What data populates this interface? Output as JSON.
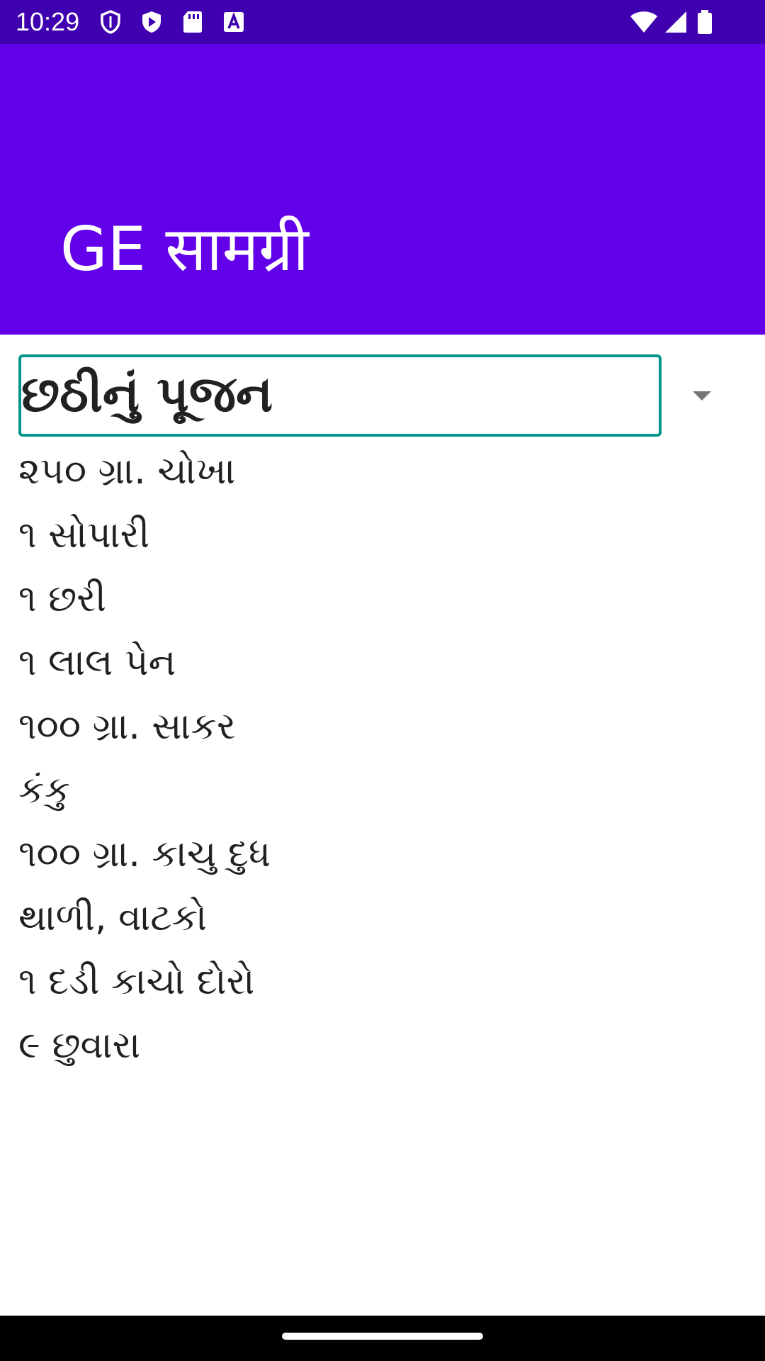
{
  "status_bar": {
    "time": "10:29",
    "left_icons": [
      "shield-icon",
      "play-protect-icon",
      "sd-card-icon",
      "font-a-icon"
    ],
    "right_icons": [
      "wifi-icon",
      "signal-icon",
      "battery-icon"
    ]
  },
  "app_bar": {
    "title": "GE सामग्री",
    "background": "#6200EA"
  },
  "spinner": {
    "selected": "છઠીનું પૂજન",
    "border_color": "#00968A",
    "arrow_icon": "dropdown-arrow-icon"
  },
  "items": [
    "૨૫૦ ગ્રા. ચોખા",
    "૧ સોપારી",
    "૧ છરી",
    "૧ લાલ પેન",
    "૧૦૦ ગ્રા. સાકર",
    "કંકુ",
    "૧૦૦ ગ્રા. કાચુ દુધ",
    "થાળી, વાટકો",
    "૧ દડી કાચો દોરો",
    "૯ છુવારા"
  ]
}
